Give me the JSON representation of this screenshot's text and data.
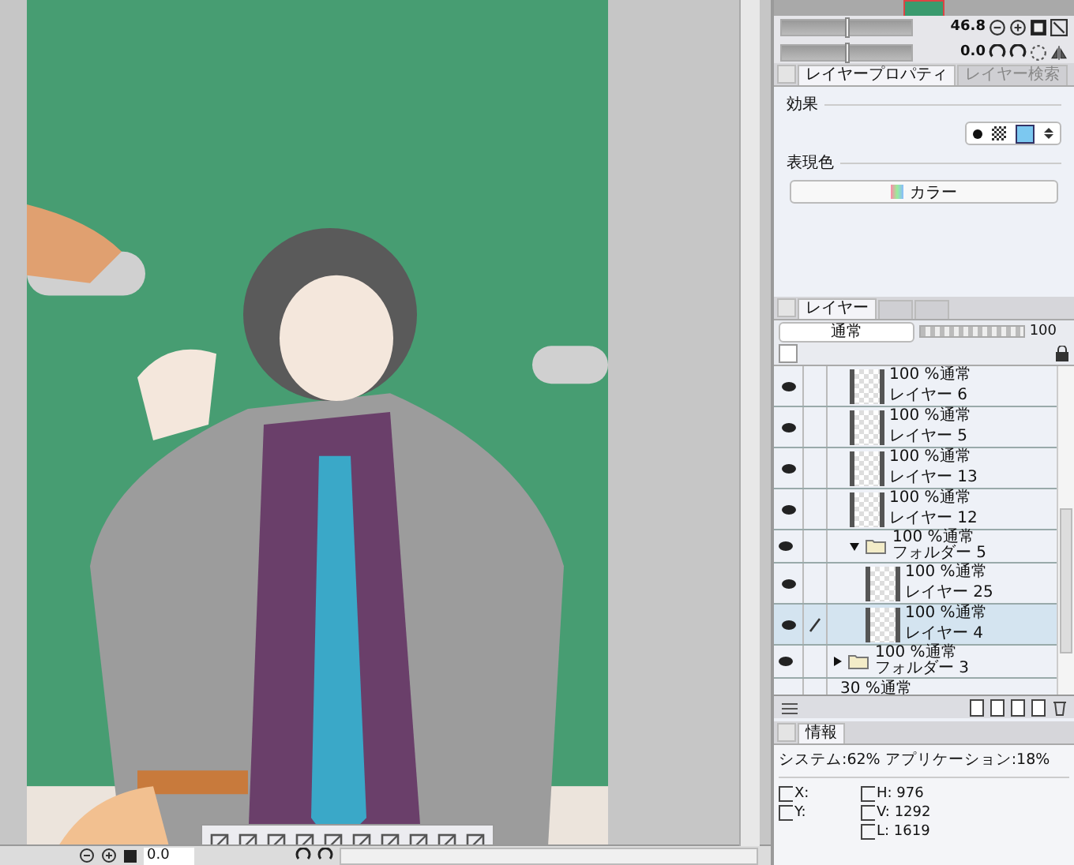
{
  "navigator": {
    "zoom": "46.8",
    "zoom_slider": {
      "level": 0.5
    },
    "angle": "0.0",
    "rotation_slider": {
      "level": 0.5
    }
  },
  "property_tabs": [
    {
      "label": "レイヤープロパティ",
      "selected": true
    },
    {
      "label": "レイヤー検索",
      "selected": false
    }
  ],
  "layer_property": {
    "effect_label": "効果",
    "color_label": "表現色",
    "color_mode": "カラー"
  },
  "layer_tabs": [
    {
      "kind": "text",
      "label": "レイヤー",
      "selected": true
    },
    {
      "kind": "icon",
      "selected": false
    },
    {
      "kind": "icon",
      "selected": false
    }
  ],
  "blend": {
    "mode": "通常",
    "opacity": "100",
    "level": 1
  },
  "layers": [
    {
      "kind": "group",
      "children": [
        {
          "kind": "layer",
          "mode": "100 %通常",
          "name": "レイヤー 6",
          "visible": true,
          "selected": false
        },
        {
          "kind": "layer",
          "mode": "100 %通常",
          "name": "レイヤー 5",
          "visible": true,
          "selected": false
        },
        {
          "kind": "layer",
          "mode": "100 %通常",
          "name": "レイヤー 13",
          "visible": true,
          "selected": false
        },
        {
          "kind": "layer",
          "mode": "100 %通常",
          "name": "レイヤー 12",
          "visible": true,
          "selected": false
        },
        {
          "kind": "folder",
          "mode": "100 %通常",
          "name": "フォルダー 5",
          "visible": true,
          "selected": false,
          "expanded": true,
          "children": [
            {
              "kind": "layer",
              "mode": "100 %通常",
              "name": "レイヤー 25",
              "visible": true,
              "selected": false
            },
            {
              "kind": "layer",
              "mode": "100 %通常",
              "name": "レイヤー 4",
              "visible": true,
              "selected": true
            }
          ]
        }
      ]
    },
    {
      "kind": "folder",
      "mode": "100 %通常",
      "name": "フォルダー 3",
      "visible": true,
      "selected": false,
      "expanded": false
    },
    {
      "kind": "partial",
      "mode": "30 %通常"
    }
  ],
  "info": {
    "tab": "情報",
    "memory": "システム:62% アプリケーション:18%",
    "x": "X:",
    "y": "Y:",
    "h": "H: 976",
    "v": "V: 1292",
    "l": "L: 1619"
  },
  "status_bar": {
    "angle": "0.0"
  }
}
